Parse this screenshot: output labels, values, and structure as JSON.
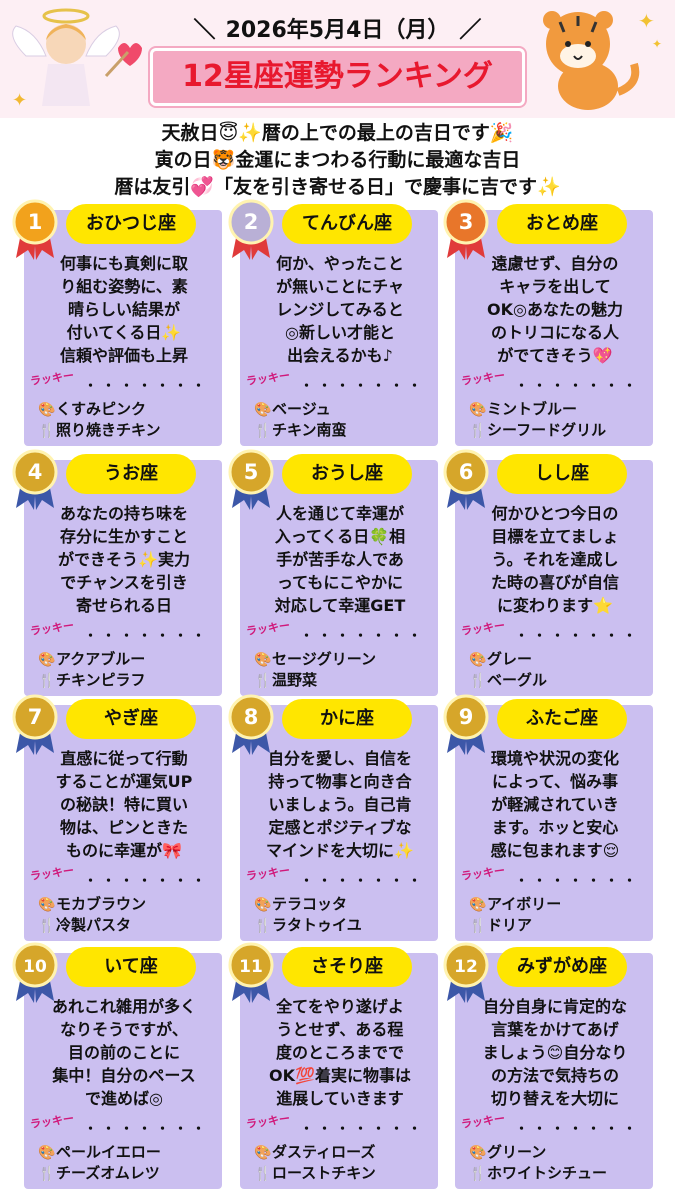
{
  "header": {
    "date": "2026年5月4日（月）",
    "title": "12星座運勢ランキング",
    "intro": [
      "天赦日😇✨暦の上での最上の吉日です🎉",
      "寅の日🐯金運にまつわる行動に最適な吉日",
      "暦は友引💞「友を引き寄せる日」で慶事に吉です✨"
    ]
  },
  "lucky_label": "ラッキー",
  "dots": "・・・・・・・",
  "colors": {
    "card": "#cbbff0",
    "pill": "#ffe600",
    "title": "#e8182e",
    "title_bg": "#f4a9c2"
  },
  "ranks": [
    {
      "rank": "1",
      "sign": "おひつじ座",
      "fortune": "何事にも真剣に取\nり組む姿勢に、素\n晴らしい結果が\n付いてくる日✨\n信頼や評価も上昇",
      "color": "くすみピンク",
      "food": "照り焼きチキン"
    },
    {
      "rank": "2",
      "sign": "てんびん座",
      "fortune": "何か、やったこと\nが無いことにチャ\nレンジしてみると\n◎新しい才能と\n出会えるかも♪",
      "color": "ベージュ",
      "food": "チキン南蛮"
    },
    {
      "rank": "3",
      "sign": "おとめ座",
      "fortune": "遠慮せず、自分の\nキャラを出して\nOK◎あなたの魅力\nのトリコになる人\nがでてきそう💖",
      "color": "ミントブルー",
      "food": "シーフードグリル"
    },
    {
      "rank": "4",
      "sign": "うお座",
      "fortune": "あなたの持ち味を\n存分に生かすこと\nができそう✨実力\nでチャンスを引き\n寄せられる日",
      "color": "アクアブルー",
      "food": "チキンピラフ"
    },
    {
      "rank": "5",
      "sign": "おうし座",
      "fortune": "人を通じて幸運が\n入ってくる日🍀相\n手が苦手な人であ\nってもにこやかに\n対応して幸運GET",
      "color": "セージグリーン",
      "food": "温野菜"
    },
    {
      "rank": "6",
      "sign": "しし座",
      "fortune": "何かひとつ今日の\n目標を立てましょ\nう。それを達成し\nた時の喜びが自信\nに変わります⭐",
      "color": "グレー",
      "food": "ベーグル"
    },
    {
      "rank": "7",
      "sign": "やぎ座",
      "fortune": "直感に従って行動\nすることが運気UP\nの秘訣！特に買い\n物は、ピンときた\nものに幸運が🎀",
      "color": "モカブラウン",
      "food": "冷製パスタ"
    },
    {
      "rank": "8",
      "sign": "かに座",
      "fortune": "自分を愛し、自信を\n持って物事と向き合\nいましょう。自己肯\n定感とポジティブな\nマインドを大切に✨",
      "color": "テラコッタ",
      "food": "ラタトゥイユ"
    },
    {
      "rank": "9",
      "sign": "ふたご座",
      "fortune": "環境や状況の変化\nによって、悩み事\nが軽減されていき\nます。ホッと安心\n感に包まれます😌",
      "color": "アイボリー",
      "food": "ドリア"
    },
    {
      "rank": "10",
      "sign": "いて座",
      "fortune": "あれこれ雑用が多く\nなりそうですが、\n目の前のことに\n集中！自分のペース\nで進めば◎",
      "color": "ペールイエロー",
      "food": "チーズオムレツ"
    },
    {
      "rank": "11",
      "sign": "さそり座",
      "fortune": "全てをやり遂げよ\nうとせず、ある程\n度のところまでで\nOK💯着実に物事は\n進展していきます",
      "color": "ダスティローズ",
      "food": "ローストチキン"
    },
    {
      "rank": "12",
      "sign": "みずがめ座",
      "fortune": "自分自身に肯定的な\n言葉をかけてあげ\nましょう😊自分なり\nの方法で気持ちの\n切り替えを大切に",
      "color": "グリーン",
      "food": "ホワイトシチュー"
    }
  ]
}
